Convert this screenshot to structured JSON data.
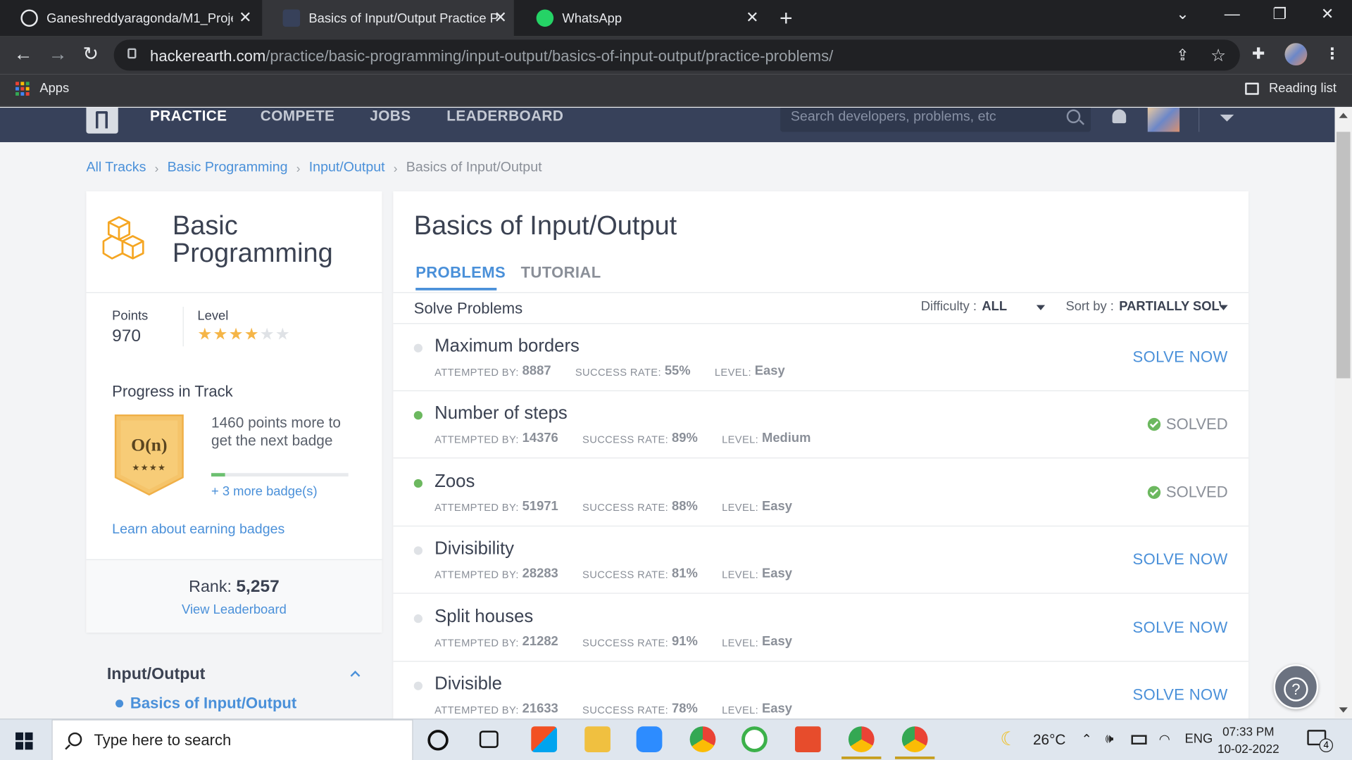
{
  "browser": {
    "tabs": [
      {
        "title": "Ganeshreddyaragonda/M1_Proje",
        "favicon": "github-icon",
        "active": false
      },
      {
        "title": "Basics of Input/Output Practice P",
        "favicon": "hackerearth-icon",
        "active": true
      },
      {
        "title": "WhatsApp",
        "favicon": "whatsapp-icon",
        "active": false
      }
    ],
    "url_host": "hackerearth.com",
    "url_path": "/practice/basic-programming/input-output/basics-of-input-output/practice-problems/",
    "bookmarks": {
      "apps_label": "Apps",
      "reading_list_label": "Reading list"
    }
  },
  "site": {
    "nav": [
      "PRACTICE",
      "COMPETE",
      "JOBS",
      "LEADERBOARD"
    ],
    "search_placeholder": "Search developers, problems, etc",
    "header_bg": "#37415a"
  },
  "breadcrumb": [
    "All Tracks",
    "Basic Programming",
    "Input/Output",
    "Basics of Input/Output"
  ],
  "sidebar": {
    "track_title_line1": "Basic",
    "track_title_line2": "Programming",
    "points_label": "Points",
    "points": "970",
    "level_label": "Level",
    "level_stars": 4,
    "level_stars_max": 6,
    "progress_title": "Progress in Track",
    "badge_text": "O(n)",
    "badge_stars": "★★★★",
    "points_more": "1460 points more to get the next badge",
    "progress_fraction": 0.1,
    "more_badges": "+ 3 more badge(s)",
    "learn_link": "Learn about earning badges",
    "rank_label": "Rank:",
    "rank_value": "5,257",
    "view_leaderboard": "View Leaderboard",
    "section_title": "Input/Output",
    "section_item": "Basics of Input/Output"
  },
  "main": {
    "title": "Basics of Input/Output",
    "tabs": [
      "PROBLEMS",
      "TUTORIAL"
    ],
    "solve_label": "Solve Problems",
    "difficulty_label": "Difficulty :",
    "difficulty_value": "ALL",
    "sort_label": "Sort by :",
    "sort_value": "PARTIALLY SOLVED",
    "meta_labels": {
      "attempted": "ATTEMPTED BY:",
      "success": "SUCCESS RATE:",
      "level": "LEVEL:"
    },
    "solve_now": "SOLVE NOW",
    "solved": "SOLVED",
    "problems": [
      {
        "name": "Maximum borders",
        "attempted": "8887",
        "success": "55%",
        "level": "Easy",
        "solved": false
      },
      {
        "name": "Number of steps",
        "attempted": "14376",
        "success": "89%",
        "level": "Medium",
        "solved": true
      },
      {
        "name": "Zoos",
        "attempted": "51971",
        "success": "88%",
        "level": "Easy",
        "solved": true
      },
      {
        "name": "Divisibility",
        "attempted": "28283",
        "success": "81%",
        "level": "Easy",
        "solved": false
      },
      {
        "name": "Split houses",
        "attempted": "21282",
        "success": "91%",
        "level": "Easy",
        "solved": false
      },
      {
        "name": "Divisible",
        "attempted": "21633",
        "success": "78%",
        "level": "Easy",
        "solved": false
      }
    ]
  },
  "taskbar": {
    "search_placeholder": "Type here to search",
    "temperature": "26°C",
    "language": "ENG",
    "time": "07:33 PM",
    "date": "10-02-2022",
    "notifications": "4"
  }
}
